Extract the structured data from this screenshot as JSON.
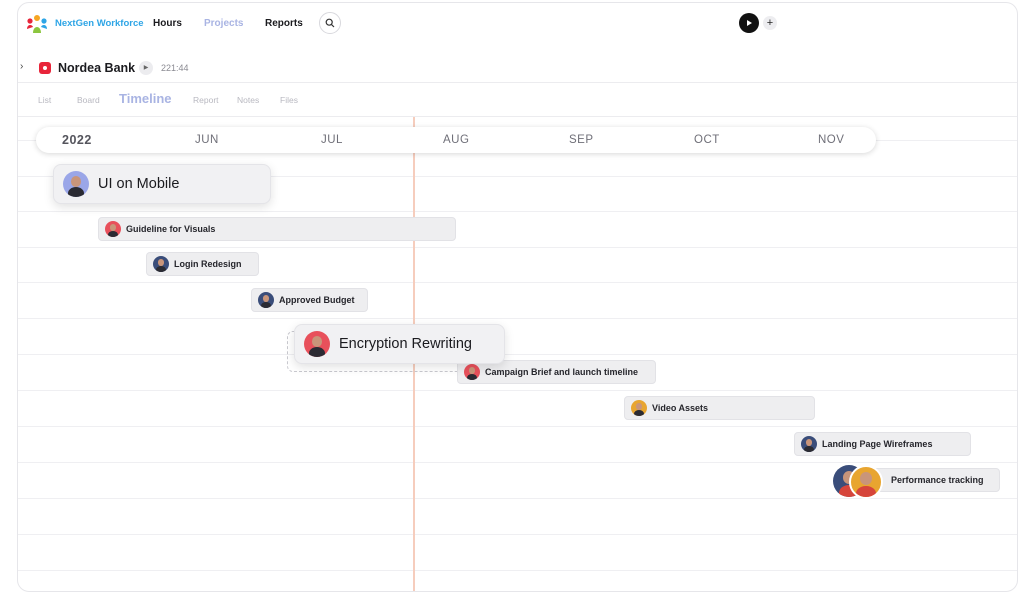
{
  "brand": {
    "name": "NextGen Workforce",
    "logo_icon": "people-logo-icon"
  },
  "nav": {
    "hours": "Hours",
    "projects": "Projects",
    "reports": "Reports",
    "search_icon": "search-icon"
  },
  "topbar": {
    "play_icon": "play-icon",
    "plus_label": "+"
  },
  "project": {
    "expand_glyph": "›",
    "name": "Nordea Bank",
    "play_glyph": "▶",
    "time": "221:44",
    "color": "#e8253a"
  },
  "tabs": [
    {
      "label": "List"
    },
    {
      "label": "Board"
    },
    {
      "label": "Timeline",
      "active": true
    },
    {
      "label": "Report"
    },
    {
      "label": "Notes"
    },
    {
      "label": "Files"
    }
  ],
  "timeline": {
    "year": "2022",
    "months": [
      "JUN",
      "JUL",
      "AUG",
      "SEP",
      "OCT",
      "NOV"
    ],
    "tasks": [
      {
        "name": "UI on Mobile",
        "avatar": "lavender"
      },
      {
        "name": "Guideline for Visuals",
        "avatar": "red"
      },
      {
        "name": "Login Redesign",
        "avatar": "blue"
      },
      {
        "name": "Approved Budget",
        "avatar": "blue"
      },
      {
        "name": "Encryption Rewriting",
        "avatar": "red"
      },
      {
        "name": "Campaign Brief and launch timeline",
        "avatar": "red"
      },
      {
        "name": "Video Assets",
        "avatar": "gold"
      },
      {
        "name": "Landing Page Wireframes",
        "avatar": "blue"
      },
      {
        "name": "Performance tracking",
        "avatar": "group"
      }
    ]
  },
  "colors": {
    "brand": "#2ea5e6",
    "active_tab": "#a9b4e3",
    "today_line": "#f6cdbd"
  }
}
